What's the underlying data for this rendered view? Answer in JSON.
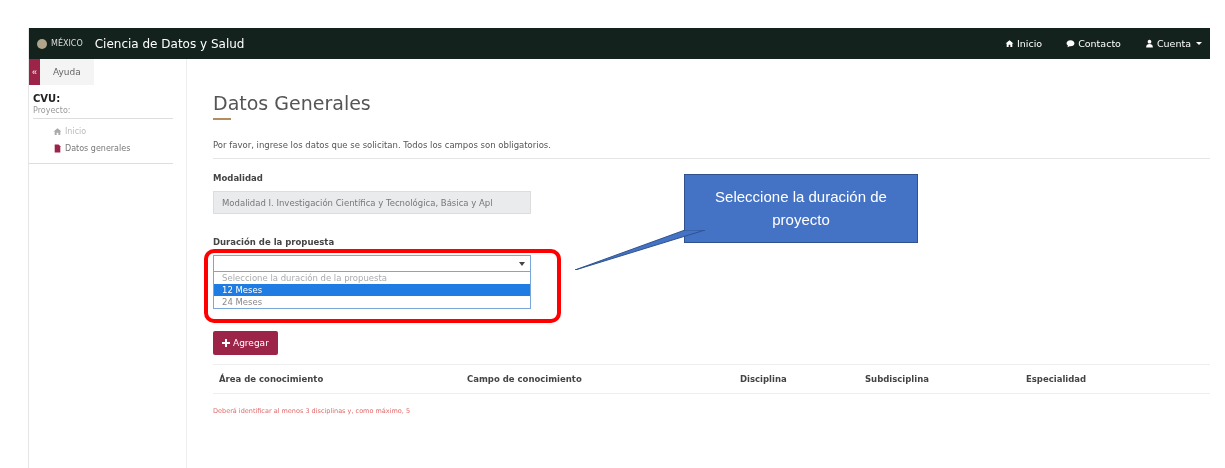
{
  "navbar": {
    "logo_text": "MÉXICO",
    "title": "Ciencia de Datos y Salud",
    "links": [
      {
        "label": "Inicio"
      },
      {
        "label": "Contacto"
      },
      {
        "label": "Cuenta",
        "dropdown": true
      }
    ]
  },
  "sidebar": {
    "toggle": "«",
    "help_tab": "Ayuda",
    "heading": "CVU:",
    "subheading": "Proyecto:",
    "items": [
      {
        "label": "Inicio",
        "selected": false
      },
      {
        "label": "Datos generales",
        "selected": true
      }
    ]
  },
  "page": {
    "title": "Datos Generales",
    "intro": "Por favor, ingrese los datos que se solicitan. Todos los campos son obligatorios.",
    "modalidad": {
      "label": "Modalidad",
      "value": "Modalidad I. Investigación Científica y Tecnológica, Básica y Apl"
    },
    "duracion": {
      "label": "Duración de la propuesta",
      "expanded": true,
      "options": [
        {
          "label": "Seleccione la duración de la propuesta",
          "selected": false
        },
        {
          "label": "12 Meses",
          "selected": true
        },
        {
          "label": "24 Meses",
          "selected": false
        }
      ]
    },
    "add_button": "Agregar",
    "table": {
      "columns": [
        "Área de conocimiento",
        "Campo de conocimiento",
        "Disciplina",
        "Subdisciplina",
        "Especialidad"
      ]
    },
    "warning": "Deberá identificar al menos 3 disciplinas y, como máximo, 5"
  },
  "callout": {
    "text": "Seleccione la duración de proyecto"
  }
}
